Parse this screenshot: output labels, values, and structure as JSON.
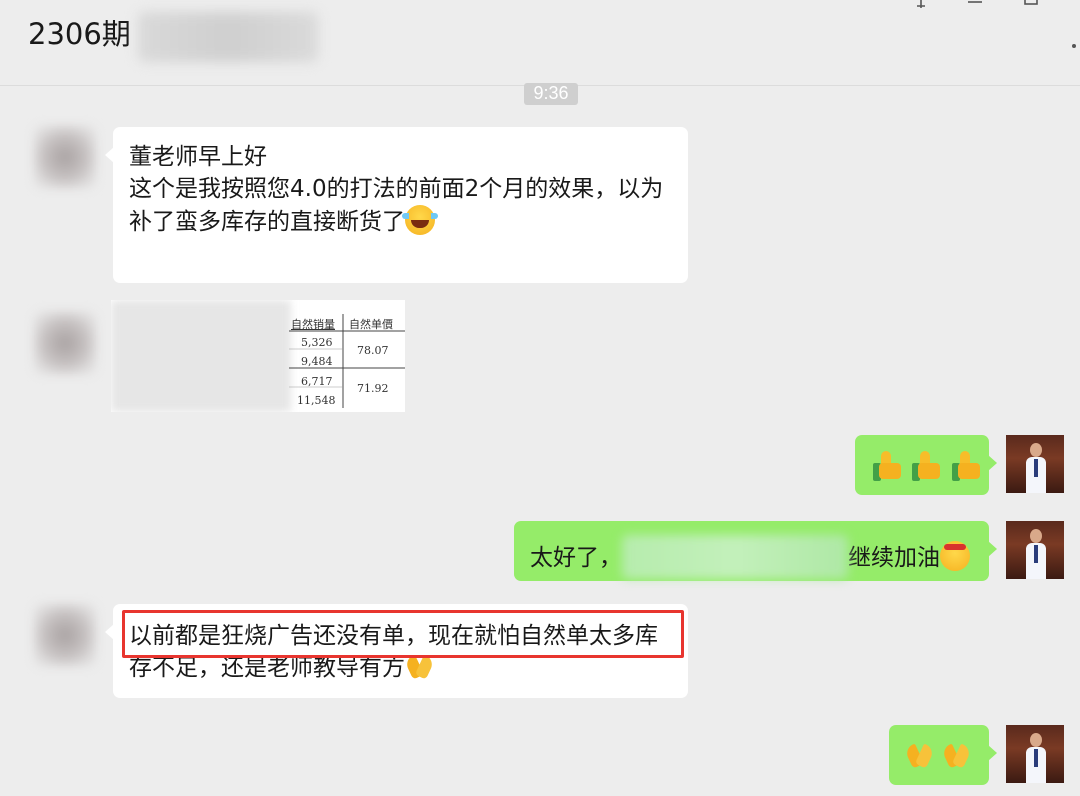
{
  "header": {
    "title": "2306期"
  },
  "timestamp": "9:36",
  "messages": {
    "m1": {
      "lines": [
        "董老师早上好",
        "这个是我按照您4.0的打法的前面2个月的效果，以为",
        "补了蛮多库存的直接断货了"
      ],
      "emoji": "tears-of-joy-emoji"
    },
    "m2": {
      "table": {
        "headers": [
          "自然销量",
          "自然单價"
        ],
        "rows": [
          [
            "5,326",
            "78.07"
          ],
          [
            "9,484",
            ""
          ],
          [
            "6,717",
            "71.92"
          ],
          [
            "11,548",
            ""
          ]
        ]
      }
    },
    "m3": {
      "emoji": [
        "thumbs-up-emoji",
        "thumbs-up-emoji",
        "thumbs-up-emoji"
      ]
    },
    "m4": {
      "prefix": "太好了，",
      "suffix": "继续加油",
      "emoji": "shushing-face-emoji"
    },
    "m5": {
      "lines": [
        "以前都是狂烧广告还没有单，现在就怕自然单太多库",
        "存不足，还是老师教导有方"
      ],
      "emoji": "folded-hands-emoji"
    },
    "m6": {
      "emoji": [
        "folded-hands-emoji",
        "folded-hands-emoji"
      ]
    }
  },
  "colors": {
    "incoming": "#ffffff",
    "outgoing": "#95ec69",
    "highlight": "#e8352f",
    "background": "#ededed"
  }
}
